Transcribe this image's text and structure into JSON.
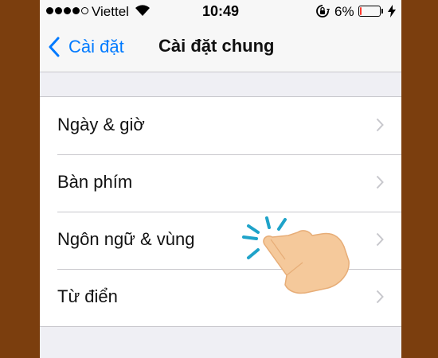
{
  "frame": {
    "color": "#7b3e0e"
  },
  "status_bar": {
    "carrier": "Viettel",
    "time": "10:49",
    "battery_percent": "6%",
    "battery_level": 0.06,
    "battery_color": "#ff3b30",
    "signal_bars_filled": 4,
    "signal_bars_total": 5,
    "icons": [
      "wifi-icon",
      "rotation-lock-icon",
      "battery-icon",
      "charging-bolt-icon"
    ]
  },
  "nav_bar": {
    "back_label": "Cài đặt",
    "title": "Cài đặt chung",
    "accent_color": "#007aff"
  },
  "settings_list": {
    "items": [
      {
        "label": "Ngày & giờ"
      },
      {
        "label": "Bàn phím"
      },
      {
        "label": "Ngôn ngữ & vùng"
      },
      {
        "label": "Từ điển"
      }
    ]
  },
  "overlay": {
    "icon": "tap-hand-icon",
    "target_item": "Ngôn ngữ & vùng",
    "hand_color": "#f5c99b",
    "tap_lines_color": "#1fa3c9"
  }
}
